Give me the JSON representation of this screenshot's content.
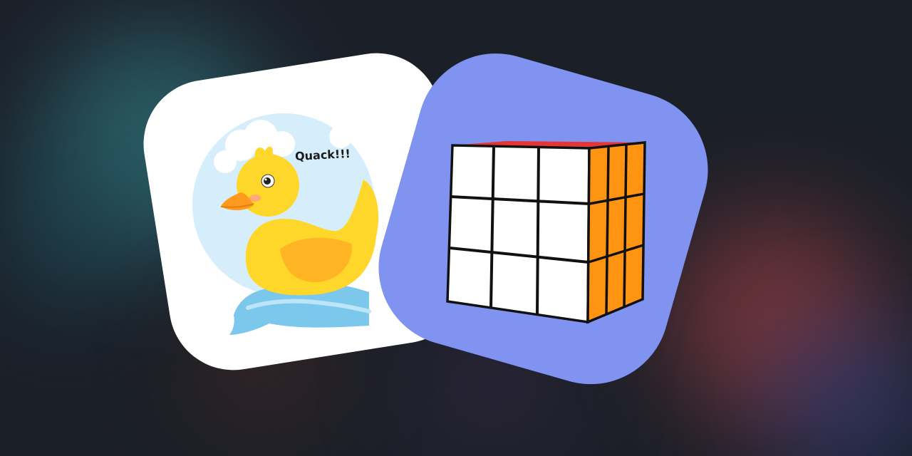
{
  "duck_card": {
    "speech_text": "Quack!!!",
    "icon": "rubber-duck-icon",
    "background_color": "#ffffff"
  },
  "cube_card": {
    "icon": "rubiks-cube-icon",
    "background_color": "#8193f0",
    "face_colors": {
      "front": "#ffffff",
      "side": "#ff9413",
      "top": "#e53535"
    }
  }
}
